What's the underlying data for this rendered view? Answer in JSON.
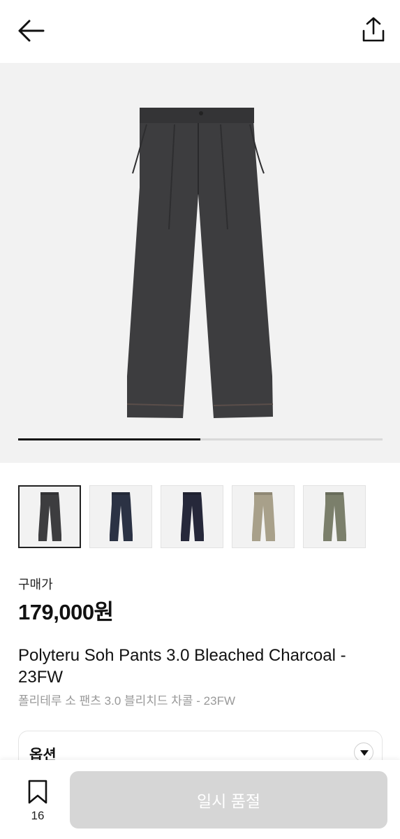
{
  "header": {
    "back_icon": "arrow-left-icon",
    "share_icon": "share-upload-icon"
  },
  "gallery": {
    "image_progress": 0.5,
    "main_image": "charcoal-wide-pleated-pants",
    "thumbnails": [
      {
        "name": "charcoal",
        "color": "#3d3d3f",
        "selected": true
      },
      {
        "name": "navy",
        "color": "#2b3244",
        "selected": false
      },
      {
        "name": "dark-navy",
        "color": "#26283a",
        "selected": false
      },
      {
        "name": "beige",
        "color": "#a8a08a",
        "selected": false
      },
      {
        "name": "olive",
        "color": "#7b7f6b",
        "selected": false
      }
    ]
  },
  "product": {
    "price_label": "구매가",
    "price": "179,000원",
    "title": "Polyteru Soh Pants 3.0 Bleached Charcoal - 23FW",
    "subtitle": "폴리테루 소 팬츠 3.0 블리치드 차콜 - 23FW"
  },
  "options": {
    "label": "옵션",
    "chevron_icon": "chevron-down-circle-icon"
  },
  "bottom_bar": {
    "bookmark_icon": "bookmark-icon",
    "bookmark_count": "16",
    "cta_label": "일시 품절",
    "cta_color": "#d6d6d6"
  }
}
